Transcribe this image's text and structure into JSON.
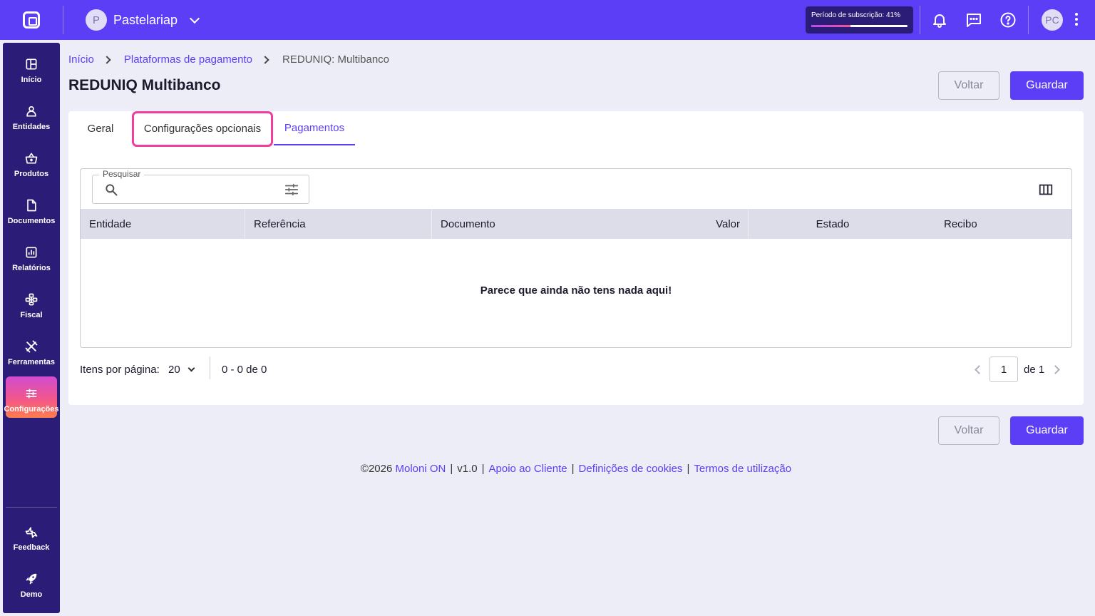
{
  "topbar": {
    "company_initial": "P",
    "company_name": "Pastelariap",
    "subscription_label": "Período de subscrição: 41%",
    "subscription_progress": 0.41,
    "user_initials": "PC",
    "icons": [
      "notifications-icon",
      "messages-icon",
      "help-icon",
      "more-vert-icon"
    ]
  },
  "sidebar": {
    "items": [
      {
        "label": "Início",
        "icon": "dashboard-icon"
      },
      {
        "label": "Entidades",
        "icon": "person-icon"
      },
      {
        "label": "Produtos",
        "icon": "basket-icon"
      },
      {
        "label": "Documentos",
        "icon": "document-icon"
      },
      {
        "label": "Relatórios",
        "icon": "chart-icon"
      },
      {
        "label": "Fiscal",
        "icon": "fiscal-icon"
      },
      {
        "label": "Ferramentas",
        "icon": "tools-icon"
      },
      {
        "label": "Configurações",
        "icon": "settings-sliders-icon",
        "active": true
      }
    ],
    "bottom_items": [
      {
        "label": "Feedback",
        "icon": "feedback-icon"
      },
      {
        "label": "Demo",
        "icon": "rocket-icon"
      }
    ]
  },
  "breadcrumb": {
    "home": "Início",
    "section": "Plataformas de pagamento",
    "current": "REDUNIQ: Multibanco"
  },
  "page": {
    "title": "REDUNIQ Multibanco",
    "back_label": "Voltar",
    "save_label": "Guardar"
  },
  "tabs": [
    {
      "label": "Geral"
    },
    {
      "label": "Configurações opcionais",
      "highlighted": true
    },
    {
      "label": "Pagamentos",
      "active": true
    }
  ],
  "table": {
    "search_label": "Pesquisar",
    "search_value": "",
    "columns": [
      "Entidade",
      "Referência",
      "Documento",
      "Valor",
      "Estado",
      "Recibo"
    ],
    "rows": [],
    "empty_message": "Parece que ainda não tens nada aqui!"
  },
  "pagination": {
    "items_per_page_label": "Itens por página:",
    "items_per_page": "20",
    "range": "0 - 0 de 0",
    "current_page": "1",
    "of_pages": "de 1"
  },
  "footer": {
    "copyright": "©2026",
    "brand": "Moloni ON",
    "version": "v1.0",
    "support": "Apoio ao Cliente",
    "cookies": "Definições de cookies",
    "terms": "Termos de utilização"
  },
  "colors": {
    "primary": "#5b3ef6",
    "sidebar": "#2b1d77",
    "highlight": "#f03d9f",
    "background": "#ecedf6"
  }
}
